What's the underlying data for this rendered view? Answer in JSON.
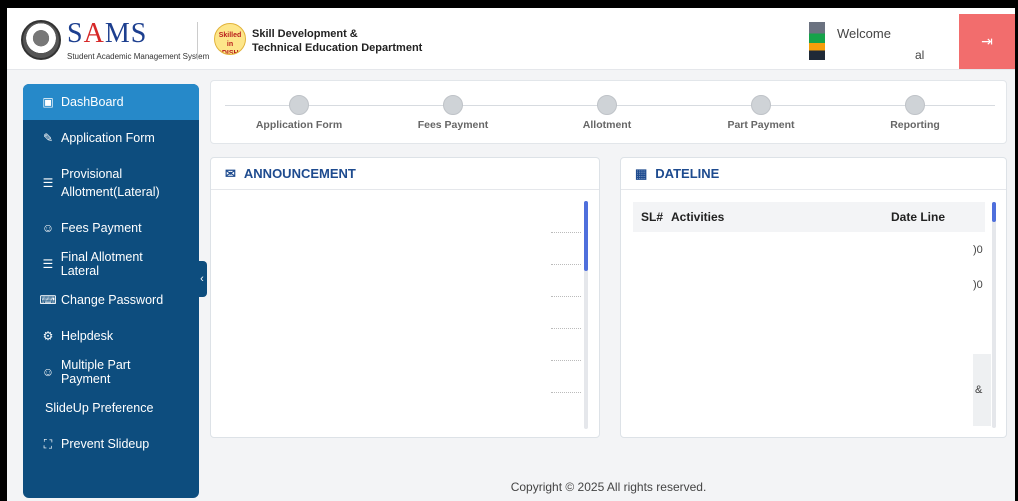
{
  "header": {
    "logo_text_part1": "S",
    "logo_text_a": "A",
    "logo_text_part2": "MS",
    "logo_subtitle": "Student Academic Management System",
    "dept_logo_text": "Skilled in ODISHA",
    "dept_line1": "Skill Development &",
    "dept_line2": "Technical Education Department",
    "welcome": "Welcome",
    "username": "al",
    "logout_icon": "logout-icon"
  },
  "sidebar": {
    "items": [
      {
        "label": "DashBoard",
        "icon": "▣",
        "active": true
      },
      {
        "label": "Application Form",
        "icon": "✎"
      },
      {
        "label": "Provisional Allotment(Lateral)",
        "icon": "☰"
      },
      {
        "label": "Fees Payment",
        "icon": "☺"
      },
      {
        "label": "Final Allotment Lateral",
        "icon": "☰"
      },
      {
        "label": "Change Password",
        "icon": "⌨"
      },
      {
        "label": "Helpdesk",
        "icon": "⚙"
      },
      {
        "label": "Multiple Part Payment",
        "icon": "☺"
      },
      {
        "label": "SlideUp Preference",
        "icon": ""
      },
      {
        "label": "Prevent Slideup",
        "icon": "⛶"
      }
    ],
    "collapse_glyph": "‹"
  },
  "progress": {
    "steps": [
      "Application Form",
      "Fees Payment",
      "Allotment",
      "Part Payment",
      "Reporting"
    ]
  },
  "announcement": {
    "title": "ANNOUNCEMENT",
    "icon": "✉"
  },
  "dateline": {
    "title": "DATELINE",
    "icon": "▦",
    "columns": [
      "SL#",
      "Activities",
      "Date Line"
    ],
    "partial_cells": [
      ")0",
      ")0",
      "&"
    ]
  },
  "footer": {
    "copyright": "Copyright © 2025 All rights reserved."
  },
  "colors": {
    "sidebar": "#0d4d7e",
    "sidebar_active": "#2689c9",
    "logout": "#f26d6d",
    "heading": "#1e4b8f"
  }
}
